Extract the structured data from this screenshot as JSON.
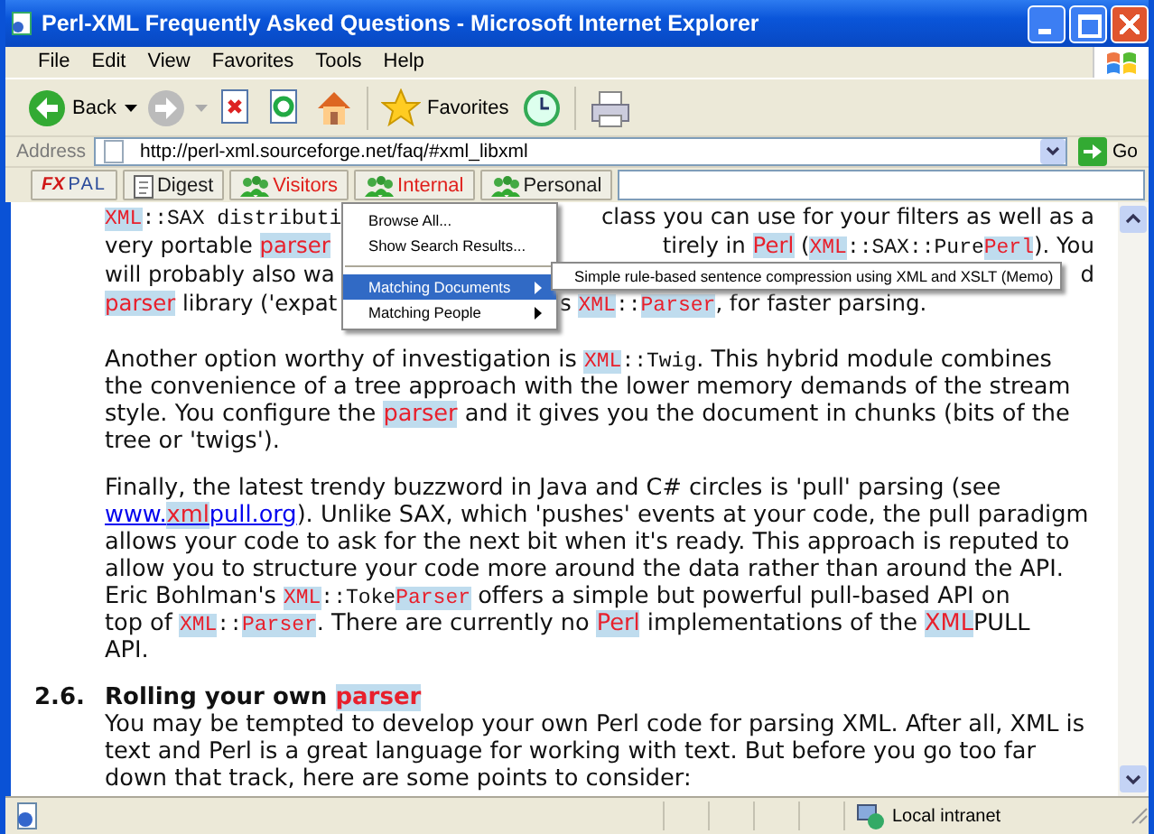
{
  "window": {
    "title": "Perl-XML Frequently Asked Questions - Microsoft Internet Explorer"
  },
  "menu_bar": [
    "File",
    "Edit",
    "View",
    "Favorites",
    "Tools",
    "Help"
  ],
  "toolbar": [
    {
      "kind": "back",
      "label": "Back"
    },
    {
      "kind": "forward"
    },
    {
      "kind": "stop"
    },
    {
      "kind": "refresh"
    },
    {
      "kind": "home"
    },
    {
      "kind": "favorites",
      "label": "Favorites"
    },
    {
      "kind": "history"
    },
    {
      "kind": "print"
    }
  ],
  "address_bar": {
    "label": "Address",
    "value": "http://perl-xml.sourceforge.net/faq/#xml_libxml",
    "go": "Go"
  },
  "links_bar": [
    {
      "kind": "logo",
      "label": "FX",
      "label2": "PAL"
    },
    {
      "kind": "digest",
      "label": "Digest"
    },
    {
      "kind": "group",
      "label": "Visitors",
      "color": "#e0201c"
    },
    {
      "kind": "group",
      "label": "Internal",
      "color": "#e0201c"
    },
    {
      "kind": "group",
      "label": "Personal",
      "color": "#1a1a1a"
    }
  ],
  "dropdown": {
    "items": [
      {
        "kind": "item",
        "label": "Browse All...",
        "selected": false
      },
      {
        "kind": "item",
        "label": "Show Search Results...",
        "selected": false
      },
      {
        "kind": "separator"
      },
      {
        "kind": "submenu",
        "label": "Matching Documents",
        "selected": true
      },
      {
        "kind": "submenu",
        "label": "Matching People",
        "selected": false
      }
    ],
    "submenu": [
      "Simple rule-based sentence compression using XML and XSLT (Memo)"
    ]
  },
  "content": [
    {
      "kind": "covered",
      "lines": [
        {
          "left": [
            {
              "kind": "code_hit",
              "text": "XML"
            },
            {
              "kind": "code",
              "text": "::SAX distributi"
            }
          ],
          "right": [
            "class you can use for your filters as well as a"
          ]
        },
        {
          "left": [
            "very portable ",
            {
              "kind": "hit",
              "text": "parser"
            }
          ],
          "right": [
            "tirely in ",
            {
              "kind": "hit",
              "text": "Perl"
            },
            " (",
            {
              "kind": "code_hit",
              "text": "XML"
            },
            {
              "kind": "code",
              "text": "::SAX::Pure"
            },
            {
              "kind": "code_hit",
              "text": "Perl"
            },
            "). You"
          ]
        },
        {
          "left": [
            "will probably also wa"
          ],
          "right": [
            "d"
          ]
        },
        {
          "left": [
            {
              "kind": "hit",
              "text": "parser"
            },
            " library ('expat"
          ],
          "right": [
            "s ",
            {
              "kind": "code_hit",
              "text": "XML"
            },
            {
              "kind": "code",
              "text": "::"
            },
            {
              "kind": "code_hit",
              "text": "Parser"
            },
            ", for faster parsing."
          ]
        }
      ]
    },
    {
      "kind": "paragraph",
      "lines": [
        [
          "Another option worthy of investigation is ",
          {
            "kind": "code_hit",
            "text": "XML"
          },
          {
            "kind": "code",
            "text": "::Twig"
          },
          ". This hybrid module combines"
        ],
        [
          "the convenience of a tree approach with the lower memory demands of the stream"
        ],
        [
          "style. You configure the ",
          {
            "kind": "hit",
            "text": "parser"
          },
          " and it gives you the document in chunks (bits of the"
        ],
        [
          "tree or 'twigs')."
        ]
      ]
    },
    {
      "kind": "paragraph",
      "lines": [
        [
          "Finally, the latest trendy buzzword in Java and C# circles is 'pull' parsing (see"
        ],
        [
          {
            "kind": "link",
            "parts": [
              "www.",
              {
                "kind": "hit",
                "text": "xml"
              },
              "pull.org"
            ]
          },
          "). Unlike SAX, which 'pushes' events at your code, the pull paradigm"
        ],
        [
          "allows your code to ask for the next bit when it's ready. This approach is reputed to"
        ],
        [
          "allow you to structure your code more around the data rather than around the API."
        ],
        [
          "Eric Bohlman's ",
          {
            "kind": "code_hit",
            "text": "XML"
          },
          {
            "kind": "code",
            "text": "::Toke"
          },
          {
            "kind": "code_hit",
            "text": "Parser"
          },
          " offers a simple but powerful pull-based API on"
        ],
        [
          "top of ",
          {
            "kind": "code_hit",
            "text": "XML"
          },
          {
            "kind": "code",
            "text": "::"
          },
          {
            "kind": "code_hit",
            "text": "Parser"
          },
          ". There are currently no ",
          {
            "kind": "hit",
            "text": "Perl"
          },
          " implementations of the ",
          {
            "kind": "hit",
            "text": "XML"
          },
          "PULL"
        ],
        [
          "API."
        ]
      ]
    },
    {
      "kind": "heading",
      "number": "2.6.",
      "lines": [
        [
          "Rolling your own ",
          {
            "kind": "hit",
            "text": "parser"
          }
        ]
      ]
    },
    {
      "kind": "paragraph",
      "lines": [
        [
          "You may be tempted to develop your own Perl code for parsing XML. After all, XML is"
        ],
        [
          "text and Perl is a great language for working with text. But before you go too far"
        ],
        [
          "down that track, here are some points to consider:"
        ]
      ]
    }
  ],
  "status_bar": {
    "zone": "Local intranet"
  }
}
